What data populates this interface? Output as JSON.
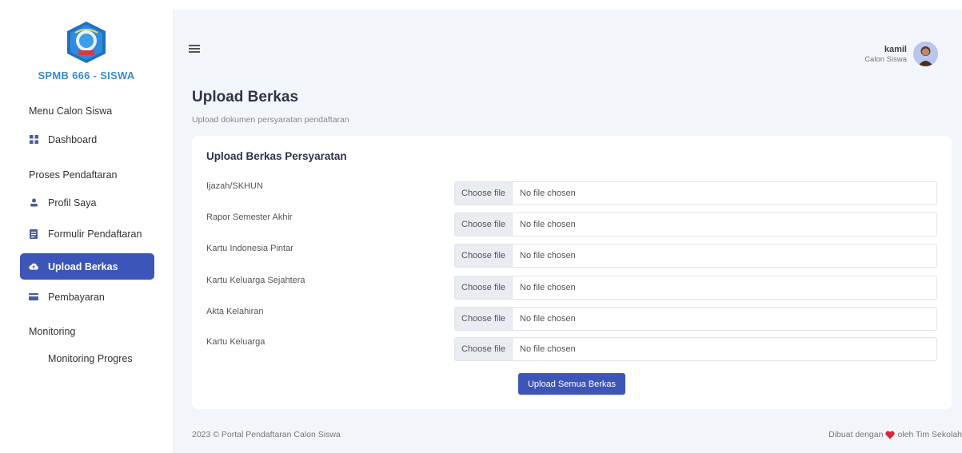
{
  "brand": {
    "name": "SPMB 666 - SISWA"
  },
  "sidebar": {
    "sections": [
      {
        "heading": "Menu Calon Siswa"
      },
      {
        "heading": "Proses Pendaftaran"
      },
      {
        "heading": "Monitoring"
      }
    ],
    "items": [
      {
        "label": "Dashboard",
        "icon": "grid-icon"
      },
      {
        "label": "Profil Saya",
        "icon": "user-icon"
      },
      {
        "label": "Formulir Pendaftaran",
        "icon": "document-icon"
      },
      {
        "label": "Upload Berkas",
        "icon": "cloud-upload-icon",
        "active": true
      },
      {
        "label": "Pembayaran",
        "icon": "credit-card-icon"
      },
      {
        "label": "Monitoring Progres"
      }
    ]
  },
  "header": {
    "user_name": "kamil",
    "user_role": "Calon Siswa"
  },
  "page": {
    "title": "Upload Berkas",
    "subtitle": "Upload dokumen persyaratan pendaftaran"
  },
  "card": {
    "title": "Upload Berkas Persyaratan",
    "choose_label": "Choose file",
    "no_file_label": "No file chosen",
    "fields": [
      {
        "label": "Ijazah/SKHUN"
      },
      {
        "label": "Rapor Semester Akhir"
      },
      {
        "label": "Kartu Indonesia Pintar"
      },
      {
        "label": "Kartu Keluarga Sejahtera"
      },
      {
        "label": "Akta Kelahiran"
      },
      {
        "label": "Kartu Keluarga"
      }
    ],
    "submit_label": "Upload Semua Berkas"
  },
  "footer": {
    "copyright": "2023 © Portal Pendaftaran Calon Siswa",
    "made_prefix": "Dibuat dengan",
    "made_suffix": "oleh Tim Sekolah"
  },
  "colors": {
    "primary": "#3d55b8",
    "brand_text": "#3a8bd4",
    "background": "#f2f6fb",
    "heart": "#e0253a"
  }
}
